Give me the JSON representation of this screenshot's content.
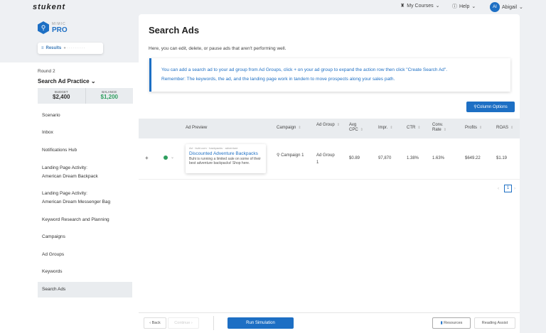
{
  "header": {
    "logo": "stukent",
    "my_courses": "My Courses",
    "help": "Help",
    "user_initials": "AI",
    "user_name": "Abigail"
  },
  "brand": {
    "small": "MIMIC",
    "large": "PRO"
  },
  "results_label": "Results",
  "sidebar": {
    "round": "Round 2",
    "title": "Search Ad Practice",
    "budget_label": "BUDGET",
    "budget": "$2,400",
    "balance_label": "BALANCE",
    "balance": "$1,200",
    "items": [
      {
        "label": "Scenario"
      },
      {
        "label": "Inbox"
      },
      {
        "label": "Notifications Hub"
      },
      {
        "label": "Landing Page Activity:",
        "sub": "American Dream Backpack"
      },
      {
        "label": "Landing Page Activity:",
        "sub": "American Dream Messenger Bag"
      },
      {
        "label": "Keyword Research and Planning"
      },
      {
        "label": "Campaigns"
      },
      {
        "label": "Ad Groups"
      },
      {
        "label": "Keywords"
      },
      {
        "label": "Search Ads"
      }
    ]
  },
  "main": {
    "title": "Search Ads",
    "subtitle": "Here, you can edit, delete, or pause ads that aren't performing well.",
    "info_line1": "You can add a search ad to your ad group from Ad Groups, click + on your ad group to expand the action row then click \"Create Search Ad\".",
    "info_line2": "Remember: The keywords, the ad, and the landing page work in tandem to move prospects along your sales path.",
    "column_options": "Column Options",
    "columns": [
      "Ad Preview",
      "Campaign",
      "Ad Group",
      "Avg CPC",
      "Impr.",
      "CTR",
      "Conv. Rate",
      "Profits",
      "ROAS"
    ],
    "row": {
      "expand": "+",
      "ad_url": "Ad · buhi.com · backpacks · adventure",
      "ad_headline": "Discounted Adventure Backpacks",
      "ad_desc": "Buhi is running a limited sale on some of their best adventure backpacks! Shop here.",
      "campaign": "Campaign 1",
      "ad_group": "Ad Group 1",
      "avg_cpc": "$0.89",
      "impr": "97,870",
      "ctr": "1.38%",
      "conv_rate": "1.63%",
      "profits": "$649.22",
      "roas": "$1.19",
      "status_color": "#2e9e5e"
    },
    "page": "1"
  },
  "footer": {
    "back": "‹ Back",
    "continue": "Continue ›",
    "run": "Run Simulation",
    "resources": "Resources",
    "reading": "Reading Assist"
  },
  "colors": {
    "accent": "#1d6fc4",
    "balance": "#2e9e5e"
  }
}
